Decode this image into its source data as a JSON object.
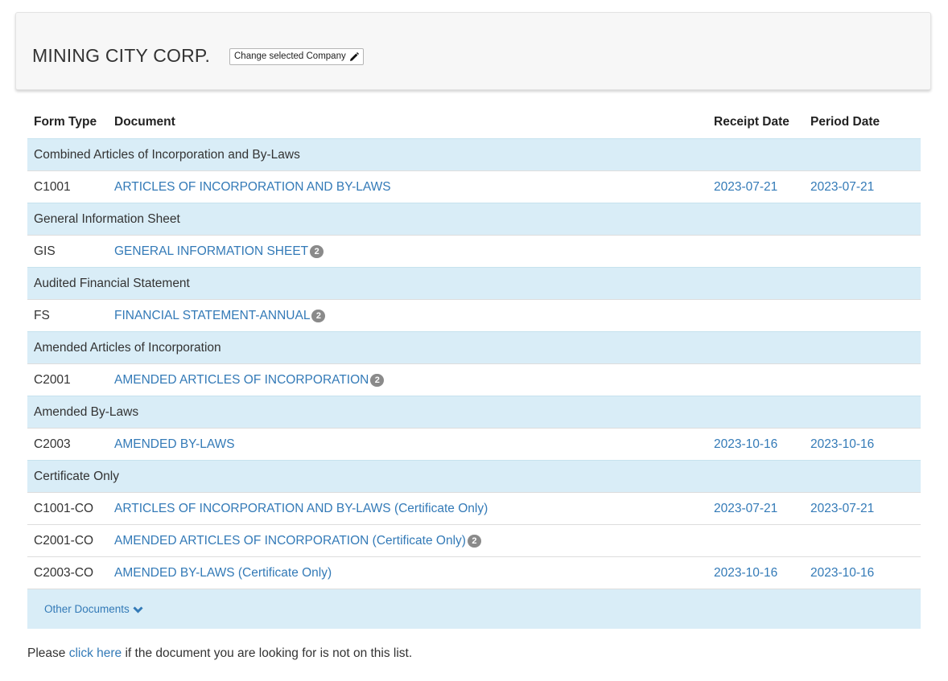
{
  "company": {
    "name": "MINING CITY CORP.",
    "change_button_label": "Change selected Company",
    "change_button_icon": "pencil-icon"
  },
  "table": {
    "headers": {
      "form_type": "Form Type",
      "document": "Document",
      "receipt_date": "Receipt Date",
      "period_date": "Period Date"
    },
    "groups": [
      {
        "title": "Combined Articles of Incorporation and By-Laws",
        "rows": [
          {
            "form": "C1001",
            "document": "ARTICLES OF INCORPORATION AND BY-LAWS",
            "badge": "",
            "receipt": "2023-07-21",
            "period": "2023-07-21"
          }
        ]
      },
      {
        "title": "General Information Sheet",
        "rows": [
          {
            "form": "GIS",
            "document": "GENERAL INFORMATION SHEET",
            "badge": "2",
            "receipt": "",
            "period": ""
          }
        ]
      },
      {
        "title": "Audited Financial Statement",
        "rows": [
          {
            "form": "FS",
            "document": "FINANCIAL STATEMENT-ANNUAL",
            "badge": "2",
            "receipt": "",
            "period": ""
          }
        ]
      },
      {
        "title": "Amended Articles of Incorporation",
        "rows": [
          {
            "form": "C2001",
            "document": "AMENDED ARTICLES OF INCORPORATION",
            "badge": "2",
            "receipt": "",
            "period": ""
          }
        ]
      },
      {
        "title": "Amended By-Laws",
        "rows": [
          {
            "form": "C2003",
            "document": "AMENDED BY-LAWS",
            "badge": "",
            "receipt": "2023-10-16",
            "period": "2023-10-16"
          }
        ]
      },
      {
        "title": "Certificate Only",
        "rows": [
          {
            "form": "C1001-CO",
            "document": "ARTICLES OF INCORPORATION AND BY-LAWS (Certificate Only)",
            "badge": "",
            "receipt": "2023-07-21",
            "period": "2023-07-21"
          },
          {
            "form": "C2001-CO",
            "document": "AMENDED ARTICLES OF INCORPORATION (Certificate Only)",
            "badge": "2",
            "receipt": "",
            "period": ""
          },
          {
            "form": "C2003-CO",
            "document": "AMENDED BY-LAWS (Certificate Only)",
            "badge": "",
            "receipt": "2023-10-16",
            "period": "2023-10-16"
          }
        ]
      }
    ],
    "other_documents": {
      "label": "Other Documents",
      "icon": "chevron-down-icon"
    }
  },
  "footer": {
    "prefix": "Please ",
    "link": "click here",
    "suffix": " if the document you are looking for is not on this list."
  },
  "colors": {
    "link": "#337ab7",
    "group_bg": "#d9edf7",
    "badge_bg": "#8a8a8a",
    "panel_bg": "#f7f7f7"
  }
}
